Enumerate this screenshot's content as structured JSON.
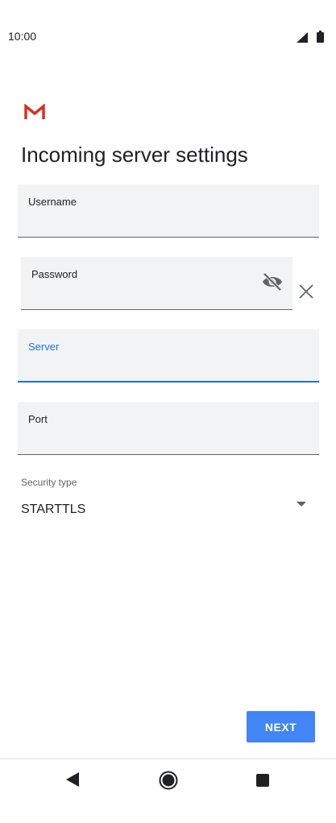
{
  "status_bar": {
    "time": "10:00",
    "icons": [
      "signal-icon",
      "battery-icon"
    ]
  },
  "app": {
    "logo_icon": "gmail-icon",
    "brand_color": "#d93025"
  },
  "page": {
    "title": "Incoming server settings"
  },
  "form": {
    "username": {
      "label": "Username",
      "value": ""
    },
    "password": {
      "label": "Password",
      "value": "",
      "toggle_icon": "visibility-off-icon",
      "clear_icon": "close-icon"
    },
    "server": {
      "label": "Server",
      "value": "",
      "focused": true
    },
    "port": {
      "label": "Port",
      "value": ""
    },
    "security_type": {
      "label": "Security type",
      "value": "STARTTLS",
      "dropdown_icon": "dropdown-arrow-icon"
    }
  },
  "actions": {
    "next_label": "NEXT"
  },
  "nav_bar": {
    "icons": [
      "back-icon",
      "home-icon",
      "recents-icon"
    ]
  },
  "colors": {
    "accent": "#1a73e8",
    "button": "#4285f4",
    "field_background": "#f1f3f4"
  }
}
